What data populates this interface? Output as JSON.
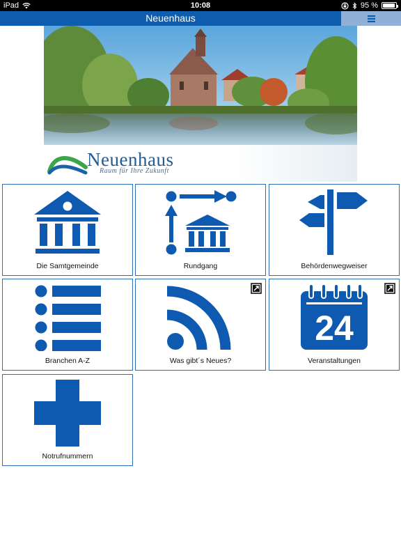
{
  "status_bar": {
    "device": "iPad",
    "time": "10:08",
    "battery": "95 %",
    "battery_level": 0.95
  },
  "header": {
    "title": "Neuenhaus",
    "menu_icon": "menu-icon"
  },
  "hero": {
    "logo_text": "Neuenhaus",
    "slogan": "Raum für Ihre Zukunft"
  },
  "tiles": [
    {
      "label": "Die Samtgemeinde",
      "icon": "town-hall-icon"
    },
    {
      "label": "Rundgang",
      "icon": "route-icon"
    },
    {
      "label": "Behördenwegweiser",
      "icon": "signpost-icon"
    },
    {
      "label": "Branchen A-Z",
      "icon": "list-icon",
      "external": false
    },
    {
      "label": "Was gibt´s Neues?",
      "icon": "rss-icon",
      "external": true
    },
    {
      "label": "Veranstaltungen",
      "icon": "calendar-icon",
      "external": true,
      "calendar_day": "24"
    },
    {
      "label": "Notrufnummern",
      "icon": "cross-icon"
    }
  ],
  "colors": {
    "brand": "#0f5dae",
    "icon": "#0d5ab0",
    "menu_bg": "#8fb1d8",
    "tile_border": "#2f6db4"
  }
}
